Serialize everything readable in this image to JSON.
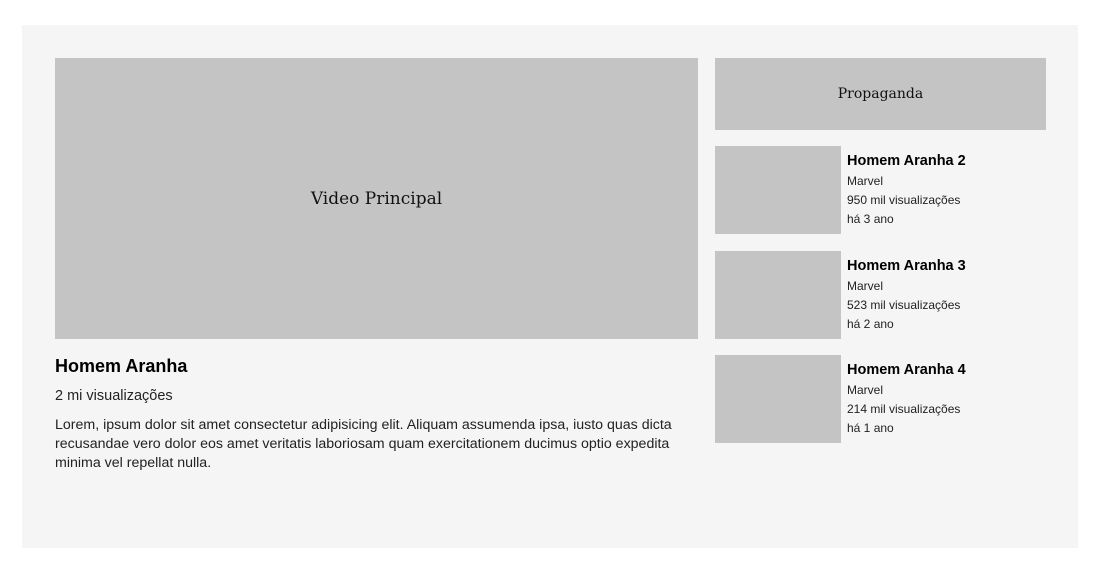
{
  "main_video": {
    "placeholder_label": "Video Principal",
    "title": "Homem Aranha",
    "views": "2 mi visualizações",
    "description": "Lorem, ipsum dolor sit amet consectetur adipisicing elit. Aliquam assumenda ipsa, iusto quas dicta recusandae vero dolor eos amet veritatis laboriosam quam exercitationem ducimus optio expedita minima vel repellat nulla."
  },
  "ad": {
    "label": "Propaganda"
  },
  "related": [
    {
      "title": "Homem Aranha 2",
      "channel": "Marvel",
      "views": "950 mil visualizações",
      "age": "há 3 ano"
    },
    {
      "title": "Homem Aranha 3",
      "channel": "Marvel",
      "views": "523 mil visualizações",
      "age": "há 2 ano"
    },
    {
      "title": "Homem Aranha 4",
      "channel": "Marvel",
      "views": "214 mil visualizações",
      "age": "há 1 ano"
    }
  ]
}
